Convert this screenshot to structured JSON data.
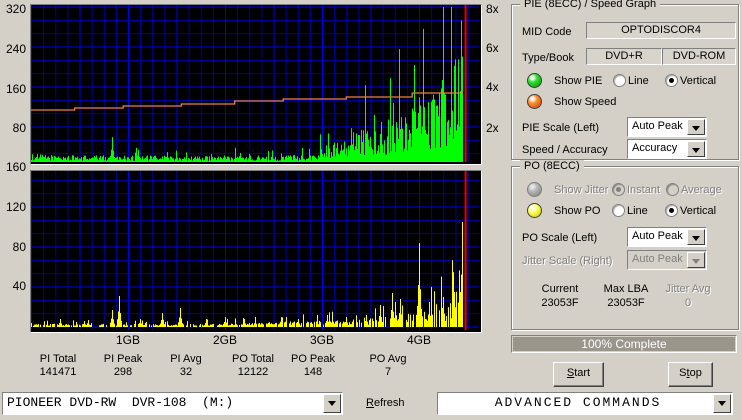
{
  "colors": {
    "window_bg": "#d4d0c8",
    "plot_bg": "#000000",
    "grid_minor": "#0000a8",
    "grid_major": "#0000f0",
    "pie_series": "#00ff00",
    "po_series": "#ffff00",
    "speed_line": "#f08040",
    "cursor_line": "#e80000",
    "progress_fill": "#9a968c"
  },
  "chart_data": [
    {
      "type": "bar",
      "title": "PIE (8ECC) / Speed Graph",
      "x_ticks": [
        "1GB",
        "2GB",
        "3GB",
        "4GB"
      ],
      "y_left_ticks": [
        80,
        160,
        240,
        320
      ],
      "ylim": [
        0,
        320
      ],
      "y_right_ticks": [
        "2x",
        "4x",
        "6x",
        "8x"
      ],
      "y_right_lim": [
        0,
        8.15
      ],
      "grid": true,
      "series": [
        {
          "name": "PIE",
          "style": "vertical-bars",
          "x_end_gb": 4.45,
          "envelope": [
            [
              0,
              10
            ],
            [
              0.3,
              8
            ],
            [
              1.0,
              8
            ],
            [
              2.0,
              7
            ],
            [
              2.9,
              9
            ],
            [
              3.1,
              25
            ],
            [
              3.4,
              40
            ],
            [
              3.7,
              52
            ],
            [
              3.95,
              68
            ],
            [
              4.15,
              85
            ],
            [
              4.3,
              110
            ],
            [
              4.38,
              140
            ],
            [
              4.45,
              150
            ]
          ],
          "spikes": [
            [
              0.84,
              50
            ],
            [
              1.1,
              24
            ],
            [
              1.4,
              20
            ],
            [
              3.15,
              38
            ],
            [
              4.0,
              130
            ],
            [
              4.2,
              92
            ],
            [
              4.33,
              115
            ],
            [
              4.43,
              285
            ]
          ]
        },
        {
          "name": "Speed",
          "style": "step-line",
          "axis": "right",
          "points": [
            [
              0,
              2.85
            ],
            [
              0.45,
              2.95
            ],
            [
              0.95,
              3.05
            ],
            [
              1.55,
              3.15
            ],
            [
              2.1,
              3.3
            ],
            [
              2.6,
              3.4
            ],
            [
              3.25,
              3.5
            ],
            [
              3.93,
              3.7
            ],
            [
              4.45,
              3.7
            ]
          ]
        }
      ],
      "cursor_gb": 4.48
    },
    {
      "type": "bar",
      "title": "PO (8ECC)",
      "x_ticks": [
        "1GB",
        "2GB",
        "3GB",
        "4GB"
      ],
      "y_left_ticks": [
        40,
        80,
        120,
        160
      ],
      "ylim": [
        0,
        160
      ],
      "grid": true,
      "series": [
        {
          "name": "PO",
          "style": "vertical-bars",
          "x_end_gb": 4.45,
          "envelope": [
            [
              0,
              2
            ],
            [
              0.5,
              2
            ],
            [
              1.0,
              2
            ],
            [
              1.5,
              2
            ],
            [
              2.0,
              2
            ],
            [
              2.4,
              3
            ],
            [
              3.0,
              4
            ],
            [
              3.3,
              5
            ],
            [
              3.6,
              7
            ],
            [
              3.9,
              9
            ],
            [
              4.1,
              13
            ],
            [
              4.3,
              18
            ],
            [
              4.45,
              30
            ]
          ],
          "spikes": [
            [
              0.3,
              8
            ],
            [
              0.55,
              6
            ],
            [
              0.84,
              17
            ],
            [
              0.91,
              31
            ],
            [
              1.12,
              8
            ],
            [
              1.35,
              14
            ],
            [
              1.54,
              19
            ],
            [
              1.8,
              8
            ],
            [
              2.0,
              10
            ],
            [
              2.2,
              8
            ],
            [
              2.75,
              8
            ],
            [
              3.05,
              12
            ],
            [
              3.25,
              10
            ],
            [
              3.45,
              12
            ],
            [
              3.6,
              22
            ],
            [
              3.72,
              34
            ],
            [
              3.8,
              28
            ],
            [
              4.0,
              84
            ],
            [
              4.1,
              25
            ],
            [
              4.25,
              30
            ],
            [
              4.35,
              35
            ],
            [
              4.44,
              105
            ]
          ]
        }
      ],
      "cursor_gb": 4.48
    }
  ],
  "stats": {
    "headers": [
      "PI Total",
      "PI Peak",
      "PI Avg",
      "PO Total",
      "PO Peak",
      "PO Avg"
    ],
    "values": [
      "141471",
      "298",
      "32",
      "12122",
      "148",
      "7"
    ]
  },
  "bottom_bar": {
    "drive_combo_value": "PIONEER DVD-RW  DVR-108  (M:)",
    "refresh": {
      "underline": "R",
      "rest": "efresh"
    },
    "commands_combo_value": "ADVANCED COMMANDS"
  },
  "pie_panel": {
    "title": "PIE (8ECC) / Speed Graph",
    "mid_code_label": "MID Code",
    "mid_code_value": "OPTODISCOR4",
    "type_book_label": "Type/Book",
    "type_value": "DVD+R",
    "book_value": "DVD-ROM",
    "show_pie_label": "Show PIE",
    "line_label": "Line",
    "vertical_label": "Vertical",
    "show_speed_label": "Show Speed",
    "pie_scale_label": "PIE Scale (Left)",
    "pie_scale_value": "Auto Peak",
    "speed_accuracy_label": "Speed / Accuracy",
    "speed_accuracy_value": "Accuracy"
  },
  "po_panel": {
    "title": "PO (8ECC)",
    "show_jitter_label": "Show Jitter",
    "instant_label": "Instant",
    "average_label": "Average",
    "show_po_label": "Show PO",
    "line_label": "Line",
    "vertical_label": "Vertical",
    "po_scale_label": "PO Scale (Left)",
    "po_scale_value": "Auto Peak",
    "jitter_scale_label": "Jitter Scale (Right)",
    "jitter_scale_value": "Auto Peak",
    "current_label": "Current",
    "current_value": "23053F",
    "max_lba_label": "Max LBA",
    "max_lba_value": "23053F",
    "jitter_avg_label": "Jitter Avg",
    "jitter_avg_value": "0"
  },
  "progress": {
    "text": "100% Complete",
    "percent": 100
  },
  "buttons": {
    "start": {
      "pre": "",
      "underline": "S",
      "rest": "tart"
    },
    "stop": {
      "pre": "S",
      "underline": "t",
      "rest": "op"
    }
  }
}
